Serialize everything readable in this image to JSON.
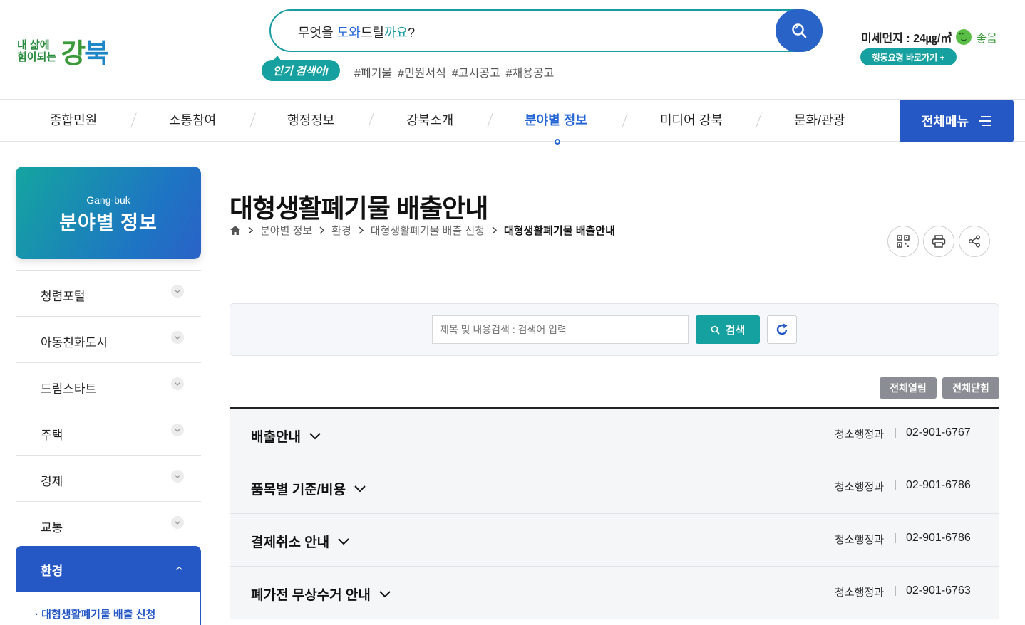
{
  "logo": {
    "line1": "내 삶에",
    "line2": "힘이되는",
    "mark1": "강",
    "mark2": "북"
  },
  "search": {
    "pre": "무엇을 ",
    "hl1": "도와",
    "mid": "드릴",
    "hl2": "까요",
    "post": "?"
  },
  "popular": {
    "label": "인기 검색어!",
    "tags": [
      "#폐기물",
      "#민원서식",
      "#고시공고",
      "#채용공고"
    ]
  },
  "dust": {
    "label": "미세먼지 : 24㎍/㎥",
    "status": "좋음"
  },
  "guide_label": "행동요령 바로가기 +",
  "gnb": {
    "items": [
      "종합민원",
      "소통참여",
      "행정정보",
      "강북소개",
      "분야별 정보",
      "미디어 강북",
      "문화/관광"
    ],
    "all_menu": "전체메뉴"
  },
  "sidebar": {
    "hero_en": "Gang-buk",
    "hero_ko": "분야별 정보",
    "items": [
      "청렴포털",
      "아동친화도시",
      "드림스타트",
      "주택",
      "경제",
      "교통"
    ],
    "active": "환경",
    "sub": "· 대형생활폐기물 배출 신청"
  },
  "page": {
    "title": "대형생활폐기물 배출안내",
    "breadcrumb": [
      "분야별 정보",
      "환경",
      "대형생활폐기물 배출 신청",
      "대형생활폐기물 배출안내"
    ]
  },
  "filter": {
    "placeholder": "제목 및 내용검색 : 검색어 입력",
    "search_label": "검색"
  },
  "toggles": {
    "open_all": "전체열림",
    "close_all": "전체닫힘"
  },
  "accordion": [
    {
      "title": "배출안내",
      "dept": "청소행정과",
      "tel": "02-901-6767"
    },
    {
      "title": "품목별 기준/비용",
      "dept": "청소행정과",
      "tel": "02-901-6786"
    },
    {
      "title": "결제취소 안내",
      "dept": "청소행정과",
      "tel": "02-901-6786"
    },
    {
      "title": "폐가전 무상수거 안내",
      "dept": "청소행정과",
      "tel": "02-901-6763"
    }
  ],
  "colors": {
    "primary": "#2558c4",
    "teal": "#15a1a0",
    "green": "#3a9a3a"
  }
}
